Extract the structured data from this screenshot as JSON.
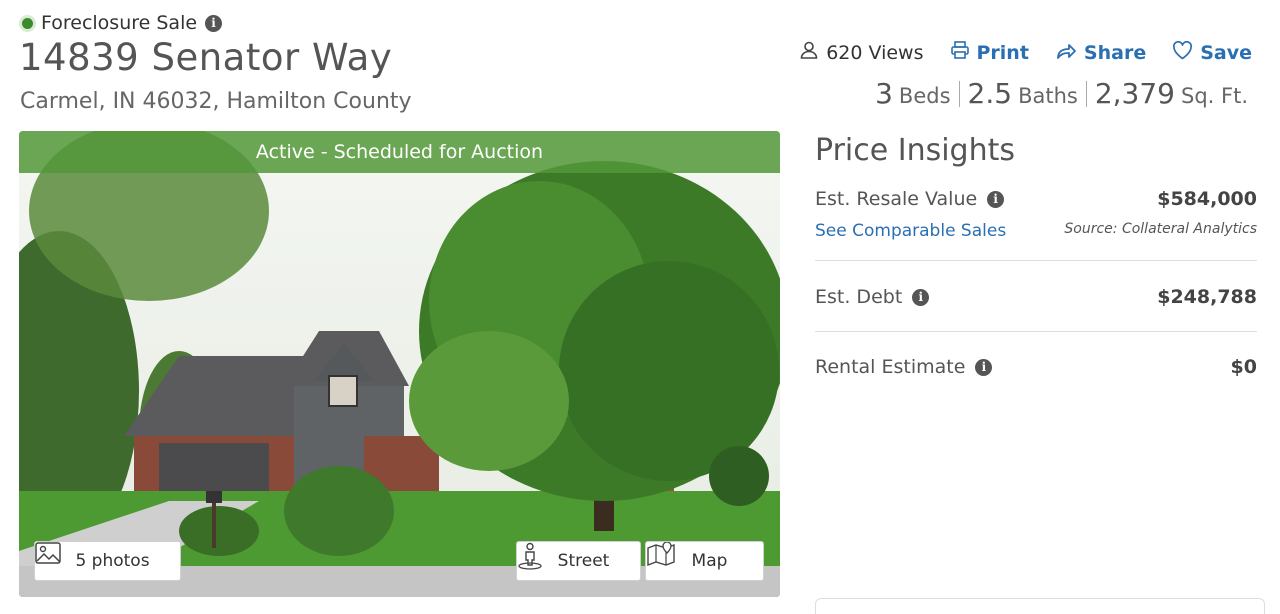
{
  "listing": {
    "status": "Foreclosure Sale",
    "address": "14839 Senator Way",
    "location": "Carmel, IN 46032, Hamilton County"
  },
  "actions": {
    "views": "620 Views",
    "print": "Print",
    "share": "Share",
    "save": "Save"
  },
  "stats": {
    "beds_num": "3",
    "beds_label": "Beds",
    "baths_num": "2.5",
    "baths_label": "Baths",
    "sqft_num": "2,379",
    "sqft_label": "Sq. Ft."
  },
  "photo": {
    "banner": "Active - Scheduled for Auction",
    "photos_button": "5 photos",
    "street_button": "Street",
    "map_button": "Map"
  },
  "insights": {
    "title": "Price Insights",
    "resale_label": "Est. Resale Value",
    "resale_value": "$584,000",
    "comparable_link": "See Comparable Sales",
    "source": "Source: Collateral Analytics",
    "debt_label": "Est. Debt",
    "debt_value": "$248,788",
    "rental_label": "Rental Estimate",
    "rental_value": "$0"
  },
  "colors": {
    "link": "#2a6fb3",
    "banner": "#52983a",
    "status_dot": "#3c8a2e"
  },
  "icons": [
    "info-icon",
    "person-icon",
    "printer-icon",
    "share-arrow-icon",
    "heart-icon",
    "image-icon",
    "street-view-icon",
    "map-icon"
  ]
}
